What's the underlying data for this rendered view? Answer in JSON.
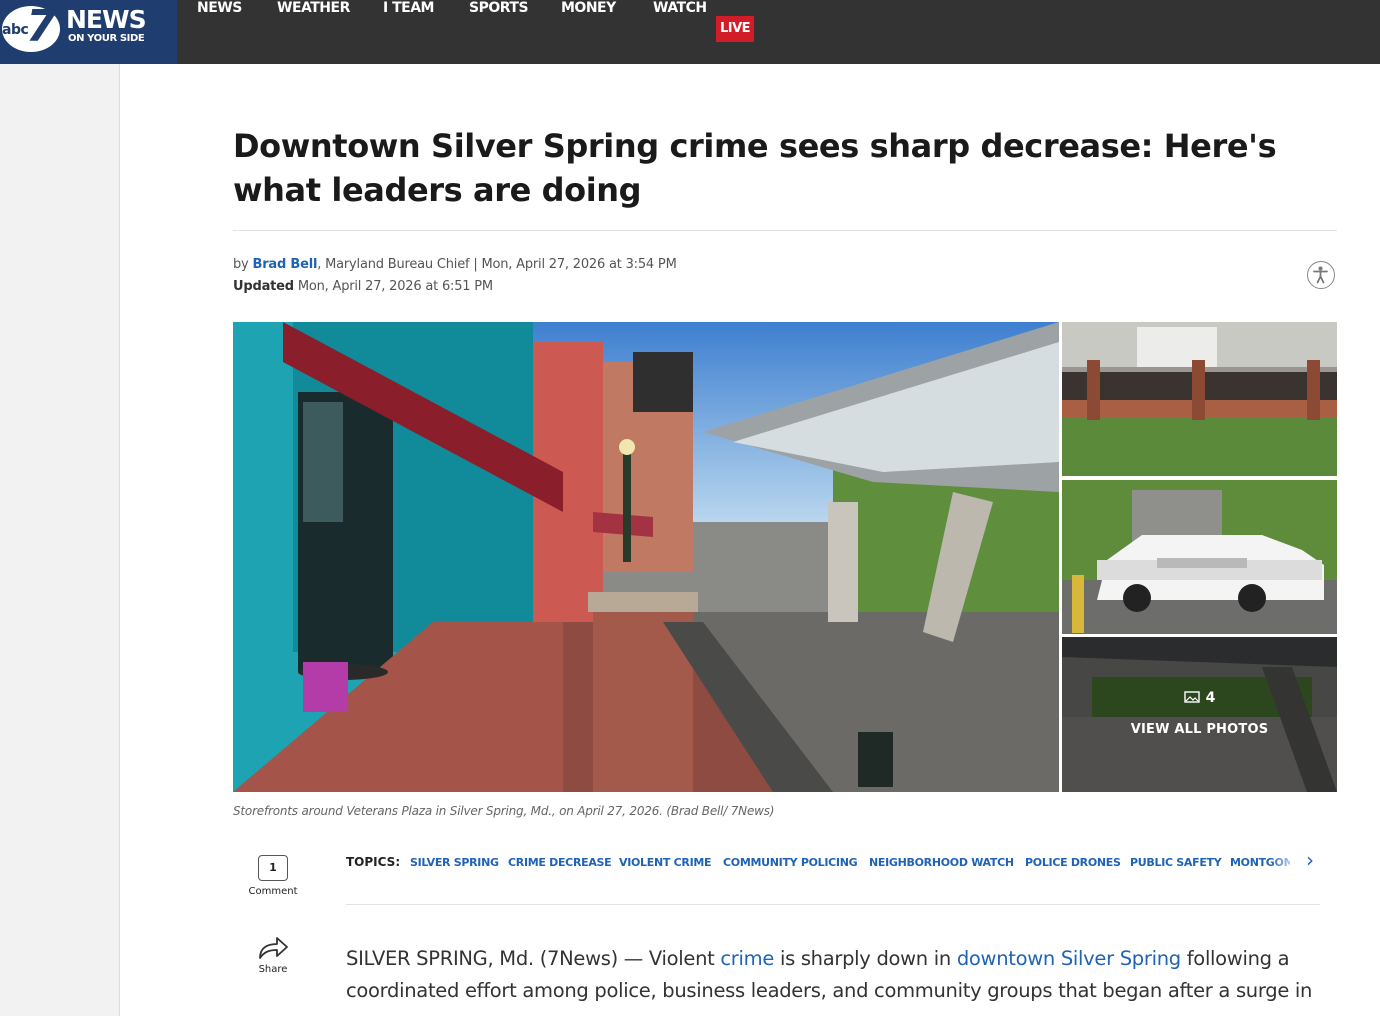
{
  "brand": {
    "logo_word": "abc",
    "logo_number": "7",
    "news": "NEWS",
    "tagline": "ON YOUR SIDE"
  },
  "nav": {
    "news": "NEWS",
    "weather": "WEATHER",
    "i_team": "I TEAM",
    "sports": "SPORTS",
    "money": "MONEY",
    "watch": "WATCH",
    "live": "LIVE"
  },
  "article": {
    "headline": "Downtown Silver Spring crime sees sharp decrease: Here's what leaders are doing",
    "by": "by",
    "author": "Brad Bell",
    "author_title": ", Maryland Bureau Chief",
    "separator": "|",
    "published": "Mon, April 27, 2026 at 3:54 PM",
    "updated_label": "Updated",
    "updated": "Mon, April 27, 2026 at 6:51 PM"
  },
  "gallery": {
    "photo_count": "4",
    "view_all": "VIEW ALL PHOTOS",
    "caption": "Storefronts around Veterans Plaza in Silver Spring, Md., on April 27, 2026. (Brad Bell/ 7News)"
  },
  "topics": {
    "label": "TOPICS:",
    "items": [
      "SILVER SPRING",
      "CRIME DECREASE",
      "VIOLENT CRIME",
      "COMMUNITY POLICING",
      "NEIGHBORHOOD WATCH",
      "POLICE DRONES",
      "PUBLIC SAFETY",
      "MONTGOMERY"
    ]
  },
  "social": {
    "comment_count": "1",
    "comment_label": "Comment",
    "share_label": "Share"
  },
  "body": {
    "p1_start": "SILVER SPRING, Md. (7News) — Violent ",
    "p1_link1": "crime",
    "p1_mid": " is sharply down in ",
    "p1_link2": "downtown Silver Spring",
    "p1_end": " following a coordinated effort among police, business leaders, and community groups that began after a surge in"
  },
  "colors": {
    "nav_bg": "#333333",
    "logo_bg": "#1f3d6e",
    "live_red": "#d21d28",
    "link_blue": "#1f63b4"
  },
  "icons": [
    "accessibility-icon",
    "photo-icon",
    "chevron-right-icon",
    "share-icon",
    "comment-icon"
  ]
}
